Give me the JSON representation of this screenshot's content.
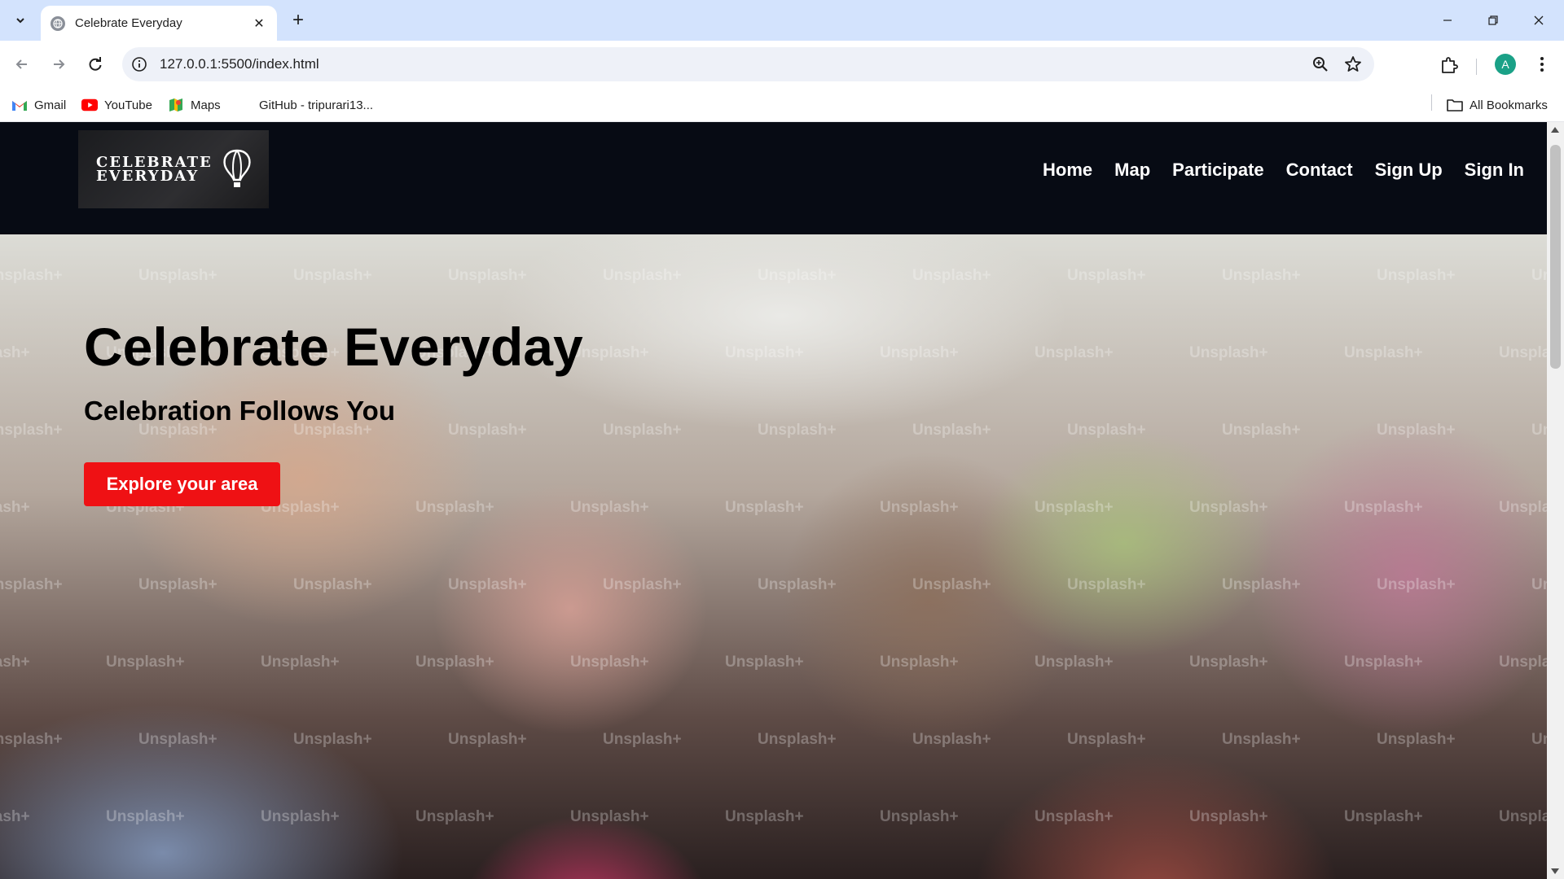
{
  "browser": {
    "tab_title": "Celebrate Everyday",
    "tab_close": "✕",
    "new_tab": "+",
    "url": "127.0.0.1:5500/index.html",
    "profile_initial": "A",
    "bookmarks": [
      {
        "label": "Gmail",
        "icon": "gmail-icon"
      },
      {
        "label": "YouTube",
        "icon": "youtube-icon"
      },
      {
        "label": "Maps",
        "icon": "maps-icon"
      },
      {
        "label": "GitHub - tripurari13...",
        "icon": "github-icon"
      }
    ],
    "all_bookmarks": "All Bookmarks"
  },
  "site": {
    "logo_line1": "CELEBRATE",
    "logo_line2": "EVERYDAY",
    "nav": [
      "Home",
      "Map",
      "Participate",
      "Contact",
      "Sign Up",
      "Sign In"
    ]
  },
  "hero": {
    "title": "Celebrate Everyday",
    "subtitle": "Celebration Follows You",
    "cta": "Explore your area",
    "watermark": "Unsplash+"
  },
  "colors": {
    "tabstrip": "#d3e3fd",
    "header_bg": "#070b14",
    "cta_bg": "#ef1114",
    "avatar": "#1aa187"
  }
}
